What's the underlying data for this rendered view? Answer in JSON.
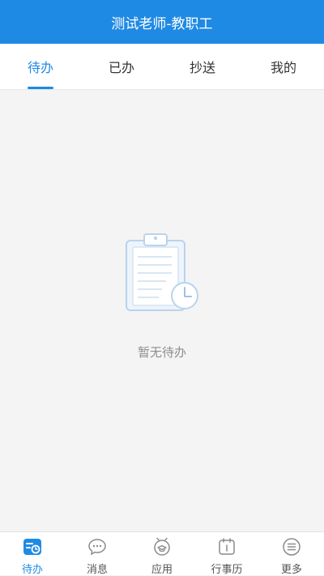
{
  "header": {
    "title": "测试老师-教职工"
  },
  "tabs": [
    {
      "label": "待办",
      "active": true
    },
    {
      "label": "已办",
      "active": false
    },
    {
      "label": "抄送",
      "active": false
    },
    {
      "label": "我的",
      "active": false
    }
  ],
  "empty": {
    "text": "暂无待办",
    "icon": "clipboard-clock-icon"
  },
  "bottom_nav": [
    {
      "label": "待办",
      "icon": "todo-icon",
      "active": true
    },
    {
      "label": "消息",
      "icon": "message-icon",
      "active": false
    },
    {
      "label": "应用",
      "icon": "apps-icon",
      "active": false
    },
    {
      "label": "行事历",
      "icon": "calendar-icon",
      "active": false
    },
    {
      "label": "更多",
      "icon": "more-icon",
      "active": false
    }
  ],
  "colors": {
    "accent": "#1f8ae4",
    "background": "#f4f4f4",
    "muted": "#8d8d8d"
  }
}
